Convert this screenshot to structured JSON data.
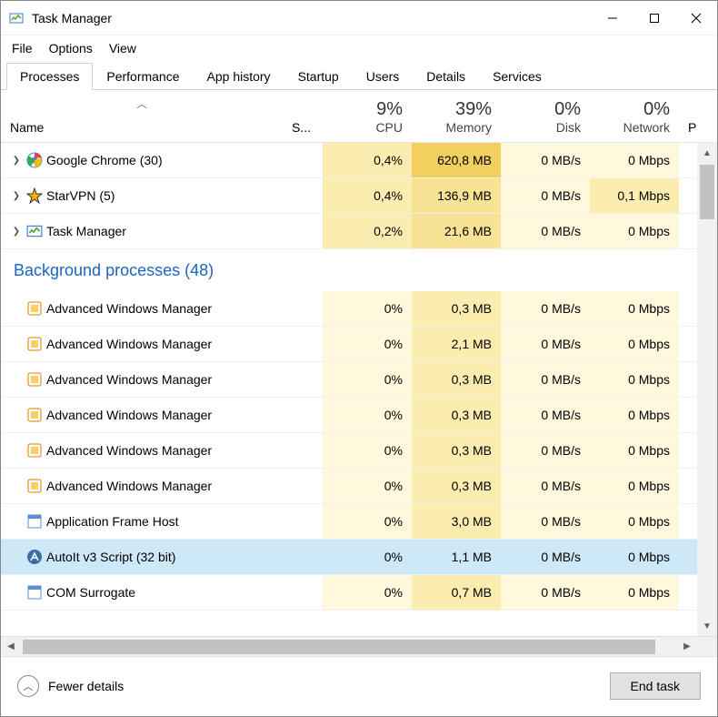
{
  "window": {
    "title": "Task Manager"
  },
  "menu": {
    "file": "File",
    "options": "Options",
    "view": "View"
  },
  "tabs": {
    "processes": "Processes",
    "performance": "Performance",
    "app_history": "App history",
    "startup": "Startup",
    "users": "Users",
    "details": "Details",
    "services": "Services"
  },
  "columns": {
    "name": "Name",
    "status": "S...",
    "cpu_pct": "9%",
    "cpu_lbl": "CPU",
    "mem_pct": "39%",
    "mem_lbl": "Memory",
    "disk_pct": "0%",
    "disk_lbl": "Disk",
    "net_pct": "0%",
    "net_lbl": "Network",
    "extra": "P"
  },
  "group_bg": "Background processes (48)",
  "processes": [
    {
      "name": "Google Chrome (30)",
      "exp": true,
      "icon": "chrome",
      "cpu": "0,4%",
      "mem": "620,8 MB",
      "disk": "0 MB/s",
      "net": "0 Mbps",
      "cpu_h": "heat1",
      "mem_h": "heat3",
      "disk_h": "heat0",
      "net_h": "heat0"
    },
    {
      "name": "StarVPN (5)",
      "exp": true,
      "icon": "star",
      "cpu": "0,4%",
      "mem": "136,9 MB",
      "disk": "0 MB/s",
      "net": "0,1 Mbps",
      "cpu_h": "heat1",
      "mem_h": "heat2",
      "disk_h": "heat0",
      "net_h": "heat1"
    },
    {
      "name": "Task Manager",
      "exp": true,
      "icon": "tm",
      "cpu": "0,2%",
      "mem": "21,6 MB",
      "disk": "0 MB/s",
      "net": "0 Mbps",
      "cpu_h": "heat1",
      "mem_h": "heat2",
      "disk_h": "heat0",
      "net_h": "heat0"
    }
  ],
  "bg_processes": [
    {
      "name": "Advanced Windows Manager",
      "icon": "awm",
      "cpu": "0%",
      "mem": "0,3 MB",
      "disk": "0 MB/s",
      "net": "0 Mbps",
      "mem_h": "heat1"
    },
    {
      "name": "Advanced Windows Manager",
      "icon": "awm",
      "cpu": "0%",
      "mem": "2,1 MB",
      "disk": "0 MB/s",
      "net": "0 Mbps",
      "mem_h": "heat1"
    },
    {
      "name": "Advanced Windows Manager",
      "icon": "awm",
      "cpu": "0%",
      "mem": "0,3 MB",
      "disk": "0 MB/s",
      "net": "0 Mbps",
      "mem_h": "heat1"
    },
    {
      "name": "Advanced Windows Manager",
      "icon": "awm",
      "cpu": "0%",
      "mem": "0,3 MB",
      "disk": "0 MB/s",
      "net": "0 Mbps",
      "mem_h": "heat1"
    },
    {
      "name": "Advanced Windows Manager",
      "icon": "awm",
      "cpu": "0%",
      "mem": "0,3 MB",
      "disk": "0 MB/s",
      "net": "0 Mbps",
      "mem_h": "heat1"
    },
    {
      "name": "Advanced Windows Manager",
      "icon": "awm",
      "cpu": "0%",
      "mem": "0,3 MB",
      "disk": "0 MB/s",
      "net": "0 Mbps",
      "mem_h": "heat1"
    },
    {
      "name": "Application Frame Host",
      "icon": "app",
      "cpu": "0%",
      "mem": "3,0 MB",
      "disk": "0 MB/s",
      "net": "0 Mbps",
      "mem_h": "heat1"
    },
    {
      "name": "AutoIt v3 Script (32 bit)",
      "icon": "autoit",
      "cpu": "0%",
      "mem": "1,1 MB",
      "disk": "0 MB/s",
      "net": "0 Mbps",
      "mem_h": "heat1",
      "selected": true
    },
    {
      "name": "COM Surrogate",
      "icon": "app",
      "cpu": "0%",
      "mem": "0,7 MB",
      "disk": "0 MB/s",
      "net": "0 Mbps",
      "mem_h": "heat1"
    }
  ],
  "footer": {
    "fewer": "Fewer details",
    "end": "End task"
  }
}
